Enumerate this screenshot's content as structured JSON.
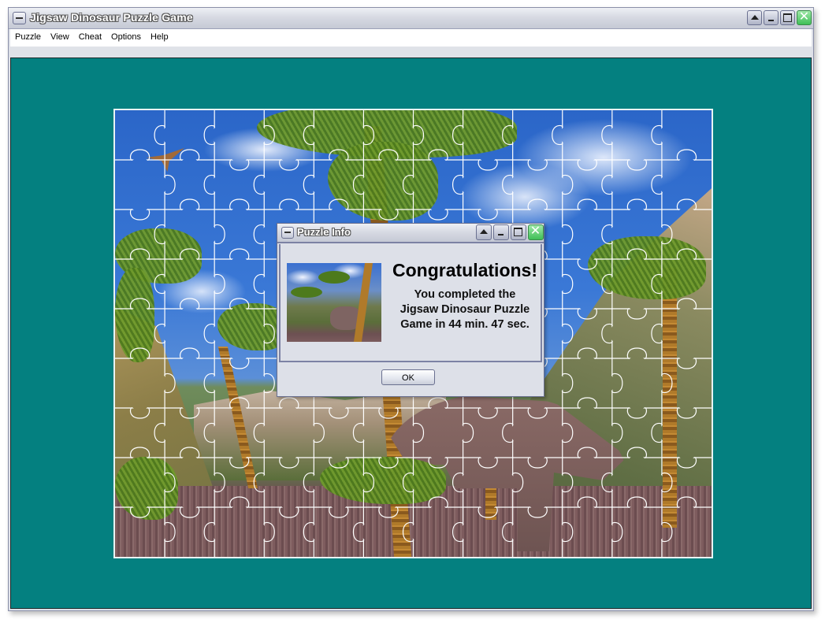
{
  "window": {
    "title": "Jigsaw Dinosaur Puzzle Game",
    "title_icon": "window-menu-icon",
    "controls": [
      {
        "name": "rollup",
        "icon": "triangle-up-icon"
      },
      {
        "name": "minimize",
        "icon": "minimize-icon"
      },
      {
        "name": "maximize",
        "icon": "maximize-icon"
      },
      {
        "name": "close",
        "icon": "close-x-icon",
        "glyph": "✕"
      }
    ]
  },
  "menubar": {
    "items": [
      "Puzzle",
      "View",
      "Cheat",
      "Options",
      "Help"
    ]
  },
  "board": {
    "background_color": "#048080",
    "puzzle": {
      "columns": 12,
      "rows": 9,
      "state": "completed",
      "image_subject": "dinosaur jungle scene with palm trees and pterodactyl"
    }
  },
  "dialog": {
    "title": "Puzzle Info",
    "heading": "Congratulations!",
    "message_lines": [
      "You completed the",
      "Jigsaw Dinosaur Puzzle",
      "Game in 44 min. 47 sec."
    ],
    "ok_label": "OK",
    "controls": [
      {
        "name": "rollup",
        "icon": "triangle-up-icon"
      },
      {
        "name": "minimize",
        "icon": "minimize-icon"
      },
      {
        "name": "maximize",
        "icon": "maximize-icon"
      },
      {
        "name": "close",
        "icon": "close-x-icon",
        "glyph": "✕"
      }
    ]
  }
}
